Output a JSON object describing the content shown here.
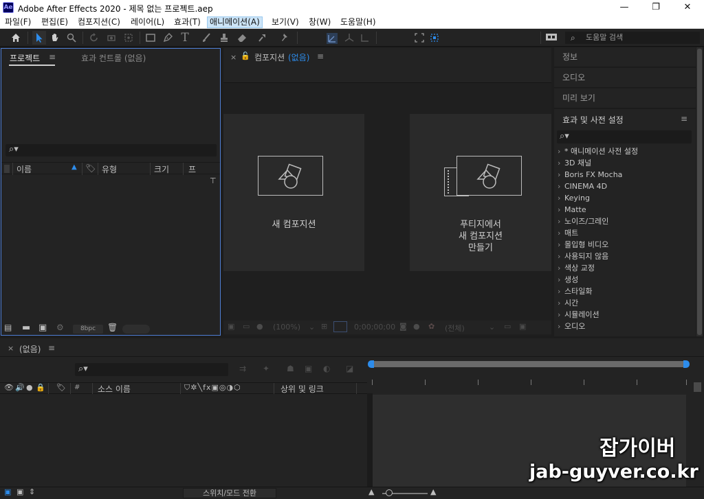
{
  "window": {
    "title": "Adobe After Effects 2020 - 제목 없는 프로젝트.aep",
    "logo": "Ae",
    "minimize": "—",
    "maximize": "❐",
    "close": "✕"
  },
  "menu": [
    "파일(F)",
    "편집(E)",
    "컴포지션(C)",
    "레이어(L)",
    "효과(T)",
    "애니메이션(A)",
    "보기(V)",
    "창(W)",
    "도움말(H)"
  ],
  "menu_active": "애니메이션(A)",
  "toolbar": {
    "snap_label": "스냅",
    "expand": "»",
    "help_search_placeholder": "도움말 검색"
  },
  "project_panel": {
    "tab_project": "프로젝트",
    "tab_effect_controls": "효과 컨트롤 (없음)",
    "columns": [
      "이름",
      "유형",
      "크기",
      "프"
    ],
    "bpc": "8bpc"
  },
  "comp_panel": {
    "tab_label": "컴포지션",
    "tab_none": "(없음)",
    "card_new_comp": "새 컴포지션",
    "card_from_footage_lines": [
      "푸티지에서",
      "새 컴포지션",
      "만들기"
    ],
    "zoom": "(100%)",
    "timecode": "0;00;00;00",
    "resolution": "(전체)"
  },
  "right_panel": {
    "tabs": [
      "정보",
      "오디오",
      "미리 보기"
    ],
    "effects_title": "효과 및 사전 설정",
    "effects": [
      "* 애니메이션 사전 설정",
      "3D 채널",
      "Boris FX Mocha",
      "CINEMA 4D",
      "Keying",
      "Matte",
      "노이즈/그레인",
      "매트",
      "몰입형 비디오",
      "사용되지 않음",
      "색상 교정",
      "생성",
      "스타일화",
      "시간",
      "시뮬레이션",
      "오디오"
    ]
  },
  "timeline": {
    "tab_label": "(없음)",
    "col_source_name": "소스 이름",
    "col_parent": "상위 및 링크",
    "col_hash": "#",
    "toggle_label": "스위치/모드 전환"
  },
  "watermark": {
    "line1": "잡가이버",
    "line2": "jab-guyver.co.kr"
  },
  "colors": {
    "accent_blue": "#2d8ceb",
    "panel_bg": "#232323",
    "active_panel_border": "#4f7fd6"
  }
}
